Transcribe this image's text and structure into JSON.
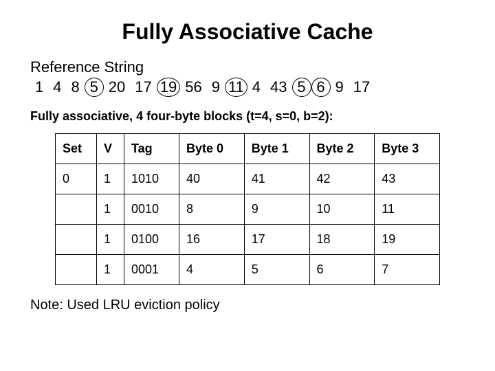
{
  "title": "Fully Associative Cache",
  "reference": {
    "label": "Reference String",
    "items": [
      {
        "v": "1",
        "c": false
      },
      {
        "v": "4",
        "c": false
      },
      {
        "v": "8",
        "c": false
      },
      {
        "v": "5",
        "c": true
      },
      {
        "v": "20",
        "c": false
      },
      {
        "v": "17",
        "c": false
      },
      {
        "v": "19",
        "c": true
      },
      {
        "v": "56",
        "c": false
      },
      {
        "v": "9",
        "c": false
      },
      {
        "v": "11",
        "c": true
      },
      {
        "v": "4",
        "c": false
      },
      {
        "v": "43",
        "c": false
      },
      {
        "v": "5",
        "c": true
      },
      {
        "v": "6",
        "c": true
      },
      {
        "v": "9",
        "c": false
      },
      {
        "v": "17",
        "c": false
      }
    ]
  },
  "subcaption": "Fully associative, 4 four-byte blocks (t=4, s=0, b=2):",
  "table": {
    "headers": [
      "Set",
      "V",
      "Tag",
      "Byte 0",
      "Byte 1",
      "Byte 2",
      "Byte 3"
    ],
    "rows": [
      {
        "set": "0",
        "v": "1",
        "tag": "1010",
        "b0": "40",
        "b1": "41",
        "b2": "42",
        "b3": "43"
      },
      {
        "set": "",
        "v": "1",
        "tag": "0010",
        "b0": "8",
        "b1": "9",
        "b2": "10",
        "b3": "11"
      },
      {
        "set": "",
        "v": "1",
        "tag": "0100",
        "b0": "16",
        "b1": "17",
        "b2": "18",
        "b3": "19"
      },
      {
        "set": "",
        "v": "1",
        "tag": "0001",
        "b0": "4",
        "b1": "5",
        "b2": "6",
        "b3": "7"
      }
    ]
  },
  "note": "Note: Used LRU eviction policy"
}
